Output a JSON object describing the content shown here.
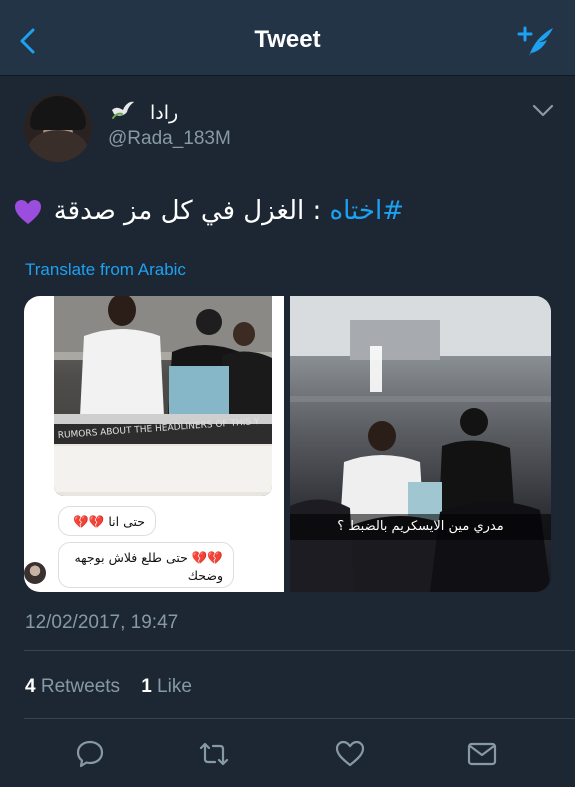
{
  "header": {
    "title": "Tweet"
  },
  "tweet": {
    "display_name": "رادا",
    "handle": "@Rada_183M",
    "hashtag": "#اختاه",
    "text": ": الغزل في كل مز صدقة",
    "translate_label": "Translate from Arabic",
    "timestamp": "12/02/2017, 19:47",
    "retweets_count": "4",
    "retweets_label": "Retweets",
    "likes_count": "1",
    "likes_label": "Like"
  },
  "media": {
    "left_photo_banner": "RUMORS ABOUT THE HEADLINERS OF THIS Y",
    "chat_bubble_1": "حتى انا",
    "chat_bubble_2": "حتى طلع فلاش بوجهه وضحك",
    "right_caption": "مدري مين الايسكريم بالضبط ؟"
  },
  "colors": {
    "background": "#1c2733",
    "header": "#243447",
    "accent": "#1da1f2",
    "muted": "#8899a6",
    "emoji_heart": "#9b4dde"
  },
  "icons": {
    "back": "back-chevron-icon",
    "compose": "compose-tweet-icon",
    "caret": "chevron-down-icon",
    "reply": "reply-icon",
    "retweet": "retweet-icon",
    "like": "heart-icon",
    "share": "envelope-icon"
  }
}
